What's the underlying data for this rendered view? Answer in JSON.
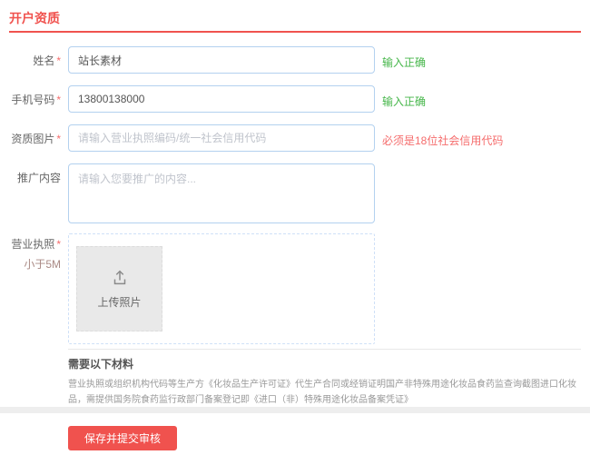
{
  "page": {
    "title": "开户资质"
  },
  "colors": {
    "accent": "#f0524e",
    "success": "#45b649",
    "error": "#f56c6c",
    "input_border": "#b3d1ef"
  },
  "form": {
    "required_mark": "*",
    "fields": [
      {
        "label": "姓名",
        "value": "站长素材",
        "hint": "输入正确"
      },
      {
        "label": "手机号码",
        "value": "13800138000",
        "hint": "输入正确"
      },
      {
        "label": "资质图片",
        "placeholder": "请输入营业执照编码/统一社会信用代码",
        "hint": "必须是18位社会信用代码"
      },
      {
        "label": "推广内容",
        "placeholder": "请输入您要推广的内容..."
      }
    ],
    "upload": {
      "label": "营业执照",
      "size_note": "小于5M",
      "button_text": "上传照片"
    },
    "materials": {
      "heading": "需要以下材料",
      "body": "营业执照或组织机构代码等生产方《化妆品生产许可证》代生产合同或经销证明国产非特殊用途化妆品食药监查询截图进口化妆品，需提供国务院食药监行政部门备案登记即《进口（非）特殊用途化妆品备案凭证》"
    },
    "submit_label": "保存并提交审核"
  }
}
